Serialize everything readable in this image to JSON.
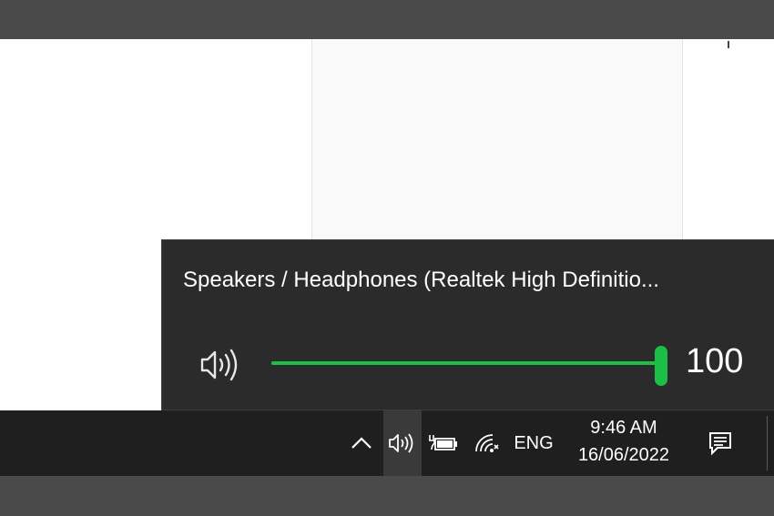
{
  "volume_flyout": {
    "device_name": "Speakers / Headphones (Realtek High Definitio...",
    "volume_value": "100",
    "volume_level": 1.0,
    "accent_color": "#1bbf47",
    "speaker_icon": "speaker-volume-icon"
  },
  "taskbar": {
    "tray_icons": [
      {
        "name": "show-hidden-icons",
        "icon": "chevron-up-icon"
      },
      {
        "name": "volume",
        "icon": "speaker-icon"
      },
      {
        "name": "battery",
        "icon": "battery-charging-icon"
      },
      {
        "name": "network",
        "icon": "wifi-icon"
      }
    ],
    "language": "ENG",
    "time": "9:46 AM",
    "date": "16/06/2022",
    "notifications_icon": "action-center-icon"
  }
}
